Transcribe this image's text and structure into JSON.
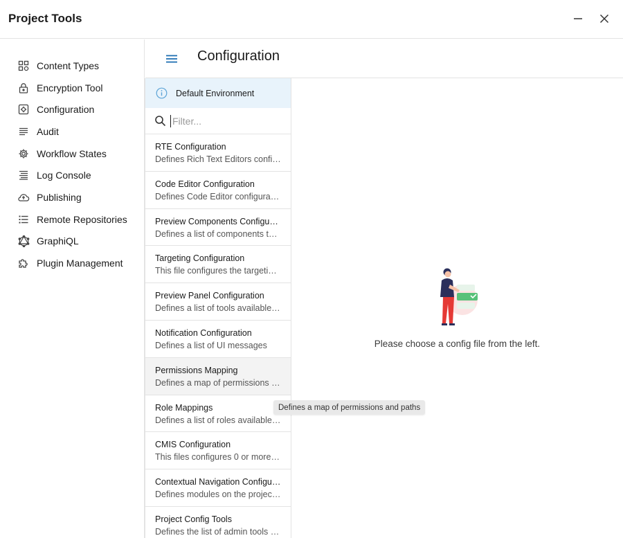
{
  "window": {
    "title": "Project Tools",
    "minimize_icon": "minimize-icon",
    "close_icon": "close-icon"
  },
  "sidebar": {
    "items": [
      {
        "label": "Content Types",
        "icon": "content-types-icon"
      },
      {
        "label": "Encryption Tool",
        "icon": "lock-icon"
      },
      {
        "label": "Configuration",
        "icon": "configuration-icon"
      },
      {
        "label": "Audit",
        "icon": "audit-list-icon"
      },
      {
        "label": "Workflow States",
        "icon": "gear-icon"
      },
      {
        "label": "Log Console",
        "icon": "log-lines-icon"
      },
      {
        "label": "Publishing",
        "icon": "cloud-upload-icon"
      },
      {
        "label": "Remote Repositories",
        "icon": "repository-list-icon"
      },
      {
        "label": "GraphiQL",
        "icon": "graphql-icon"
      },
      {
        "label": "Plugin Management",
        "icon": "puzzle-icon"
      }
    ]
  },
  "header": {
    "title": "Configuration",
    "menu_icon": "hamburger-menu-icon"
  },
  "environment": {
    "label": "Default Environment",
    "icon": "info-icon"
  },
  "filter": {
    "placeholder": "Filter...",
    "value": "",
    "icon": "search-icon"
  },
  "config_files": [
    {
      "title": "RTE Configuration",
      "description": "Defines Rich Text Editors configur…"
    },
    {
      "title": "Code Editor Configuration",
      "description": "Defines Code Editor configurations"
    },
    {
      "title": "Preview Components Configuration",
      "description": "Defines a list of components that …"
    },
    {
      "title": "Targeting Configuration",
      "description": "This file configures the targeting …"
    },
    {
      "title": "Preview Panel Configuration",
      "description": "Defines a list of tools available in …"
    },
    {
      "title": "Notification Configuration",
      "description": "Defines a list of UI messages"
    },
    {
      "title": "Permissions Mapping",
      "description": "Defines a map of permissions an…"
    },
    {
      "title": "Role Mappings",
      "description": "Defines a list of roles available in …"
    },
    {
      "title": "CMIS Configuration",
      "description": "This files configures 0 or more CM…"
    },
    {
      "title": "Contextual Navigation Configurat…",
      "description": "Defines modules on the project c…"
    },
    {
      "title": "Project Config Tools",
      "description": "Defines the list of admin tools av…"
    }
  ],
  "hovered_index": 6,
  "tooltip": {
    "text": "Defines a map of permissions and paths"
  },
  "empty_state": {
    "message": "Please choose a config file from the left.",
    "illustration": "person-choosing-illustration"
  },
  "colors": {
    "accent": "#1f6fb2",
    "banner_bg": "#e8f3fb",
    "hover_bg": "#f3f3f3",
    "illustration_green": "#59c17a",
    "illustration_red": "#e53935",
    "illustration_navy": "#2b2f5b"
  }
}
